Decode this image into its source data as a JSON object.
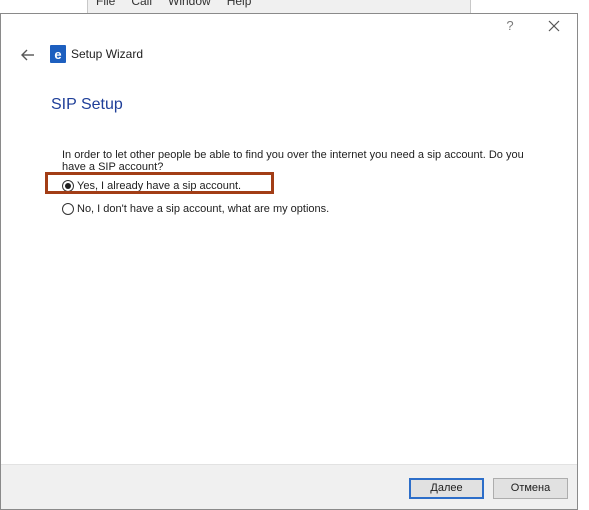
{
  "background_app": {
    "menu": [
      "File",
      "Call",
      "Window",
      "Help"
    ]
  },
  "dialog": {
    "title": "Setup Wizard",
    "help_label": "?",
    "heading": "SIP Setup",
    "question": "In order to let other people be able to find you over the internet you need a sip account. Do you have a SIP account?",
    "options": [
      {
        "label": "Yes, I already have a sip account.",
        "selected": true
      },
      {
        "label": "No, I don't have a sip account, what are my options.",
        "selected": false
      }
    ],
    "buttons": {
      "next": "Далее",
      "cancel": "Отмена"
    }
  },
  "colors": {
    "heading": "#1f3f99",
    "highlight": "#a23d16",
    "app_icon": "#1d5fbf",
    "primary_border": "#2d6ec9"
  }
}
